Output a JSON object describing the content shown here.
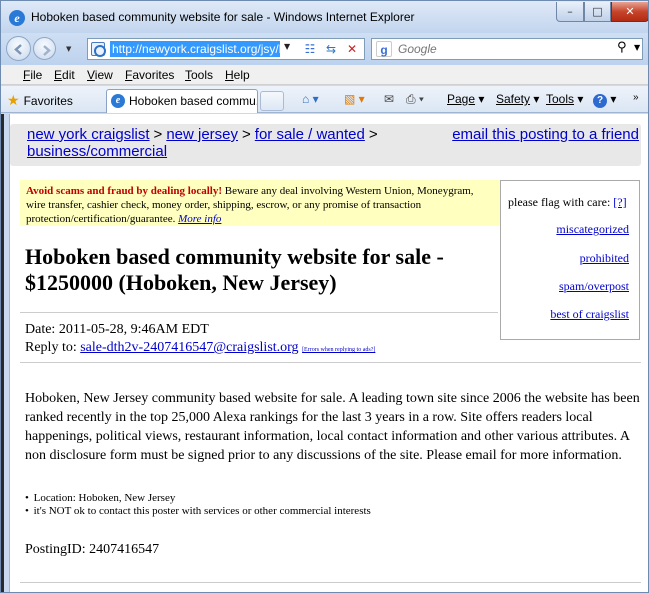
{
  "window": {
    "title": "Hoboken based community website for sale - Windows Internet Explorer",
    "min_icon": "minimize-icon",
    "max_icon": "maximize-icon",
    "close_icon": "close-icon"
  },
  "address": {
    "url": "http://newyork.craigslist.org/jsy/b",
    "search_placeholder": "Google"
  },
  "menu": [
    "File",
    "Edit",
    "View",
    "Favorites",
    "Tools",
    "Help"
  ],
  "favbar": {
    "favorites_label": "Favorites",
    "tab_title": "Hoboken based commu...",
    "page_label": "Page",
    "safety_label": "Safety",
    "tools_label": "Tools"
  },
  "breadcrumb": {
    "items": [
      "new york craigslist",
      "new jersey",
      "for sale / wanted",
      "business/commercial"
    ],
    "separator": ">",
    "email_link": "email this posting to a friend"
  },
  "warning": {
    "bold": "Avoid scams and fraud by dealing locally!",
    "text": " Beware any deal involving Western Union, Moneygram, wire transfer, cashier check, money order, shipping, escrow, or any promise of transaction protection/certification/guarantee. ",
    "link": "More info"
  },
  "flag": {
    "header": "please flag with care:",
    "help_link": "[?]",
    "items": [
      "miscategorized",
      "prohibited",
      "spam/overpost",
      "best of craigslist"
    ]
  },
  "posting": {
    "title": "Hoboken based community website for sale - $1250000 (Hoboken, New Jersey)",
    "date": "Date: 2011-05-28, 9:46AM EDT",
    "reply_label": "Reply to: ",
    "reply_email": "sale-dth2v-2407416547@craigslist.org",
    "reply_errors": "[Errors when replying to ads?]",
    "body": "Hoboken, New Jersey community based website for sale. A leading town site since 2006 the website has been ranked recently in the top 25,000 Alexa rankings for the last 3 years in a row. Site offers readers local happenings, political views, restaurant information, local contact information and other various attributes. A non disclosure form must be signed prior to any discussions of the site. Please email for more information.",
    "bullets": [
      "Location: Hoboken, New Jersey",
      "it's NOT ok to contact this poster with services or other commercial interests"
    ],
    "posting_id": "PostingID: 2407416547"
  },
  "colors": {
    "link": "#0000cc",
    "warning_bg": "#ffffc0",
    "warning_red": "#c00000"
  }
}
